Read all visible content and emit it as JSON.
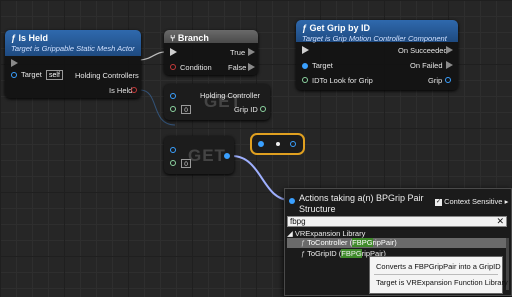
{
  "nodes": {
    "is_held": {
      "title": "Is Held",
      "subtitle": "Target is Grippable Static Mesh Actor",
      "target_label": "Target",
      "target_value": "self",
      "holding_label": "Holding Controllers",
      "isheld_label": "Is Held"
    },
    "branch": {
      "title": "Branch",
      "true_label": "True",
      "condition_label": "Condition",
      "false_label": "False"
    },
    "get_grip": {
      "title": "Get Grip by ID",
      "subtitle": "Target is Grip Motion Controller Component",
      "succeeded": "On Succeeded",
      "target_label": "Target",
      "failed": "On Failed",
      "id_label": "IDTo Look for Grip",
      "grip_label": "Grip"
    },
    "get_holding": {
      "watermark": "GET",
      "holding_label": "Holding Controller",
      "grip_id_label": "Grip ID",
      "index": "0"
    },
    "get_array": {
      "watermark": "GET",
      "index": "0"
    }
  },
  "action_menu": {
    "header": "Actions taking a(n) BPGrip Pair Structure",
    "context_sensitive_label": "Context Sensitive",
    "context_sensitive_checked": true,
    "search_value": "fbpg",
    "category": "VRExpansion Library",
    "items": [
      {
        "before": "ToController (",
        "highlight": "FBPG",
        "after": "ripPair)"
      },
      {
        "before": "ToGripID (",
        "highlight": "FBPG",
        "after": "ripPair)"
      }
    ]
  },
  "tooltip": {
    "line1": "Converts a FBPGripPair into a GripID",
    "line2": "Target is VRExpansion Function Library"
  },
  "colors": {
    "function_header": "#2b5f9c",
    "branch_header": "#5a5a5a",
    "pin_struct": "#3aa0ff",
    "reroute_border": "#e0a020",
    "search_highlight": "#3f8a2a"
  }
}
